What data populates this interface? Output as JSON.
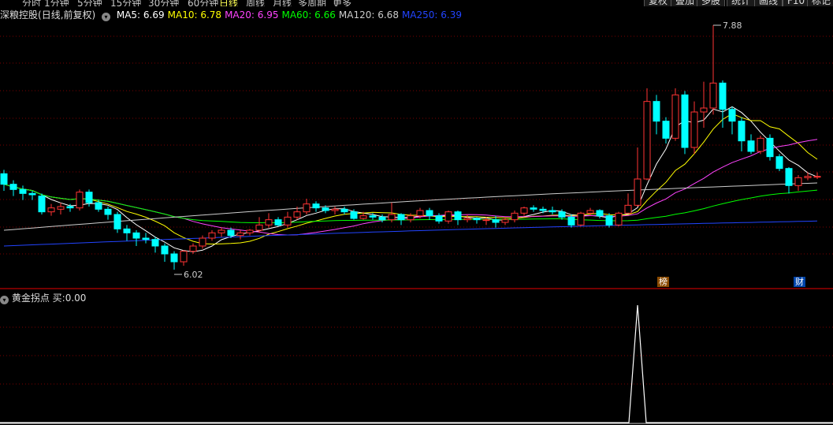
{
  "timeframes": [
    "分时",
    "1分钟",
    "5分钟",
    "15分钟",
    "30分钟",
    "60分钟",
    "日线",
    "周线",
    "月线",
    "多周期",
    "更多"
  ],
  "active_timeframe": "日线",
  "top_buttons": [
    "复权",
    "叠加",
    "多股",
    "统计",
    "画线",
    "F10",
    "标记"
  ],
  "stock": {
    "name": "深粮控股",
    "period": "(日线,前复权)"
  },
  "ma": [
    {
      "label": "MA5",
      "value": "6.69",
      "color": "#ffffff"
    },
    {
      "label": "MA10",
      "value": "6.78",
      "color": "#ffff00"
    },
    {
      "label": "MA20",
      "value": "6.95",
      "color": "#ff44ff"
    },
    {
      "label": "MA60",
      "value": "6.66",
      "color": "#00ff00"
    },
    {
      "label": "MA120",
      "value": "6.68",
      "color": "#cccccc"
    },
    {
      "label": "MA250",
      "value": "6.39",
      "color": "#2244ff"
    }
  ],
  "annotations": {
    "high": "7.88",
    "low": "6.02"
  },
  "badges": [
    "榜",
    "财"
  ],
  "indicator": {
    "name": "黄金拐点",
    "label": "买:",
    "value": "0.00"
  },
  "colors": {
    "up": "#ff3333",
    "down": "#00ffff",
    "grid": "#7a0000",
    "divider": "#990000"
  },
  "chart_data": {
    "type": "candlestick",
    "price_axis": {
      "min": 6.02,
      "max": 7.88
    },
    "candles": [
      [
        6.75,
        6.67,
        6.78,
        6.62
      ],
      [
        6.67,
        6.63,
        6.7,
        6.58
      ],
      [
        6.63,
        6.6,
        6.66,
        6.55
      ],
      [
        6.6,
        6.59,
        6.62,
        6.55
      ],
      [
        6.58,
        6.46,
        6.6,
        6.44
      ],
      [
        6.46,
        6.49,
        6.52,
        6.43
      ],
      [
        6.48,
        6.5,
        6.53,
        6.44
      ],
      [
        6.5,
        6.49,
        6.52,
        6.46
      ],
      [
        6.49,
        6.61,
        6.63,
        6.47
      ],
      [
        6.61,
        6.53,
        6.63,
        6.5
      ],
      [
        6.53,
        6.48,
        6.55,
        6.46
      ],
      [
        6.48,
        6.44,
        6.5,
        6.4
      ],
      [
        6.44,
        6.33,
        6.46,
        6.3
      ],
      [
        6.33,
        6.3,
        6.36,
        6.24
      ],
      [
        6.3,
        6.26,
        6.32,
        6.2
      ],
      [
        6.26,
        6.25,
        6.3,
        6.22
      ],
      [
        6.25,
        6.2,
        6.27,
        6.15
      ],
      [
        6.2,
        6.14,
        6.22,
        6.08
      ],
      [
        6.14,
        6.08,
        6.16,
        6.02
      ],
      [
        6.08,
        6.16,
        6.17,
        6.05
      ],
      [
        6.16,
        6.2,
        6.22,
        6.14
      ],
      [
        6.2,
        6.26,
        6.28,
        6.18
      ],
      [
        6.26,
        6.3,
        6.32,
        6.24
      ],
      [
        6.3,
        6.32,
        6.34,
        6.27
      ],
      [
        6.32,
        6.28,
        6.34,
        6.26
      ],
      [
        6.28,
        6.3,
        6.32,
        6.25
      ],
      [
        6.3,
        6.32,
        6.33,
        6.28
      ],
      [
        6.32,
        6.36,
        6.42,
        6.3
      ],
      [
        6.36,
        6.4,
        6.45,
        6.34
      ],
      [
        6.4,
        6.36,
        6.42,
        6.35
      ],
      [
        6.36,
        6.42,
        6.46,
        6.34
      ],
      [
        6.42,
        6.46,
        6.5,
        6.4
      ],
      [
        6.46,
        6.52,
        6.56,
        6.44
      ],
      [
        6.52,
        6.49,
        6.54,
        6.46
      ],
      [
        6.49,
        6.47,
        6.51,
        6.45
      ],
      [
        6.47,
        6.48,
        6.5,
        6.44
      ],
      [
        6.48,
        6.46,
        6.5,
        6.44
      ],
      [
        6.46,
        6.41,
        6.48,
        6.4
      ],
      [
        6.41,
        6.43,
        6.46,
        6.4
      ],
      [
        6.43,
        6.42,
        6.45,
        6.4
      ],
      [
        6.42,
        6.4,
        6.44,
        6.38
      ],
      [
        6.4,
        6.44,
        6.53,
        6.38
      ],
      [
        6.44,
        6.4,
        6.45,
        6.36
      ],
      [
        6.4,
        6.43,
        6.45,
        6.38
      ],
      [
        6.43,
        6.47,
        6.49,
        6.41
      ],
      [
        6.47,
        6.43,
        6.49,
        6.4
      ],
      [
        6.43,
        6.39,
        6.45,
        6.37
      ],
      [
        6.39,
        6.46,
        6.47,
        6.37
      ],
      [
        6.46,
        6.4,
        6.47,
        6.36
      ],
      [
        6.4,
        6.41,
        6.44,
        6.38
      ],
      [
        6.41,
        6.4,
        6.42,
        6.37
      ],
      [
        6.4,
        6.4,
        6.42,
        6.36
      ],
      [
        6.4,
        6.38,
        6.43,
        6.34
      ],
      [
        6.38,
        6.4,
        6.42,
        6.36
      ],
      [
        6.4,
        6.45,
        6.47,
        6.38
      ],
      [
        6.45,
        6.49,
        6.5,
        6.43
      ],
      [
        6.49,
        6.48,
        6.51,
        6.46
      ],
      [
        6.48,
        6.47,
        6.5,
        6.45
      ],
      [
        6.47,
        6.46,
        6.5,
        6.44
      ],
      [
        6.46,
        6.42,
        6.48,
        6.4
      ],
      [
        6.42,
        6.36,
        6.44,
        6.34
      ],
      [
        6.36,
        6.45,
        6.46,
        6.35
      ],
      [
        6.45,
        6.47,
        6.49,
        6.43
      ],
      [
        6.47,
        6.43,
        6.48,
        6.41
      ],
      [
        6.43,
        6.36,
        6.45,
        6.34
      ],
      [
        6.36,
        6.45,
        6.46,
        6.35
      ],
      [
        6.45,
        6.51,
        6.6,
        6.45
      ],
      [
        6.51,
        6.71,
        6.95,
        6.5
      ],
      [
        6.71,
        7.3,
        7.4,
        6.7
      ],
      [
        7.3,
        7.15,
        7.35,
        7.05
      ],
      [
        7.15,
        7.02,
        7.18,
        6.98
      ],
      [
        7.02,
        7.35,
        7.4,
        7.0
      ],
      [
        7.35,
        6.95,
        7.38,
        6.9
      ],
      [
        6.95,
        7.22,
        7.3,
        6.9
      ],
      [
        7.22,
        7.25,
        7.45,
        7.1
      ],
      [
        7.25,
        7.44,
        7.88,
        7.2
      ],
      [
        7.44,
        7.24,
        7.46,
        7.1
      ],
      [
        7.24,
        7.15,
        7.26,
        7.05
      ],
      [
        7.15,
        7.0,
        7.18,
        6.92
      ],
      [
        7.0,
        6.92,
        7.05,
        6.9
      ],
      [
        6.92,
        7.02,
        7.04,
        6.9
      ],
      [
        7.02,
        6.88,
        7.05,
        6.85
      ],
      [
        6.88,
        6.79,
        6.9,
        6.77
      ],
      [
        6.79,
        6.66,
        6.8,
        6.6
      ],
      [
        6.66,
        6.72,
        6.74,
        6.62
      ],
      [
        6.72,
        6.73,
        6.76,
        6.7
      ],
      [
        6.73,
        6.73,
        6.76,
        6.71
      ]
    ],
    "indicator_peak_index": 67
  }
}
